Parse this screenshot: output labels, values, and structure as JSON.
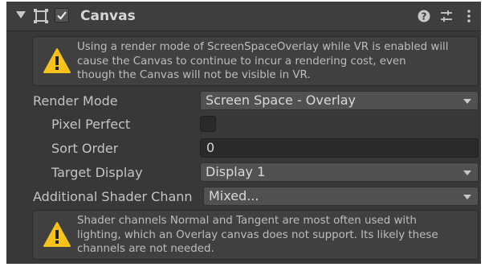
{
  "header": {
    "title": "Canvas",
    "enabled": true,
    "icons": [
      "foldout-arrow-icon",
      "canvas-component-icon",
      "help-icon",
      "presets-icon",
      "more-menu-icon"
    ]
  },
  "warning_vr": {
    "icon": "warning-icon",
    "lines": [
      "Using a render mode of ScreenSpaceOverlay while VR is enabled will",
      "cause the Canvas to continue to incur a rendering cost, even",
      "though the Canvas will not be visible in VR."
    ]
  },
  "properties": {
    "render_mode": {
      "label": "Render Mode",
      "value": "Screen Space - Overlay"
    },
    "pixel_perfect": {
      "label": "Pixel Perfect",
      "checked": false
    },
    "sort_order": {
      "label": "Sort Order",
      "value": "0"
    },
    "target_display": {
      "label": "Target Display",
      "value": "Display 1"
    },
    "additional_shader_channels": {
      "label": "Additional Shader Chann",
      "value": "Mixed..."
    }
  },
  "warning_shader": {
    "icon": "warning-icon",
    "lines": [
      "Shader channels Normal and Tangent are most often used with",
      "lighting, which an Overlay canvas does not support. Its likely these",
      "channels are not needed."
    ]
  },
  "colors": {
    "panel_bg": "#383838",
    "warning_yellow": "#f7c21a",
    "dropdown_bg": "#515151",
    "field_bg": "#2a2a2a"
  }
}
